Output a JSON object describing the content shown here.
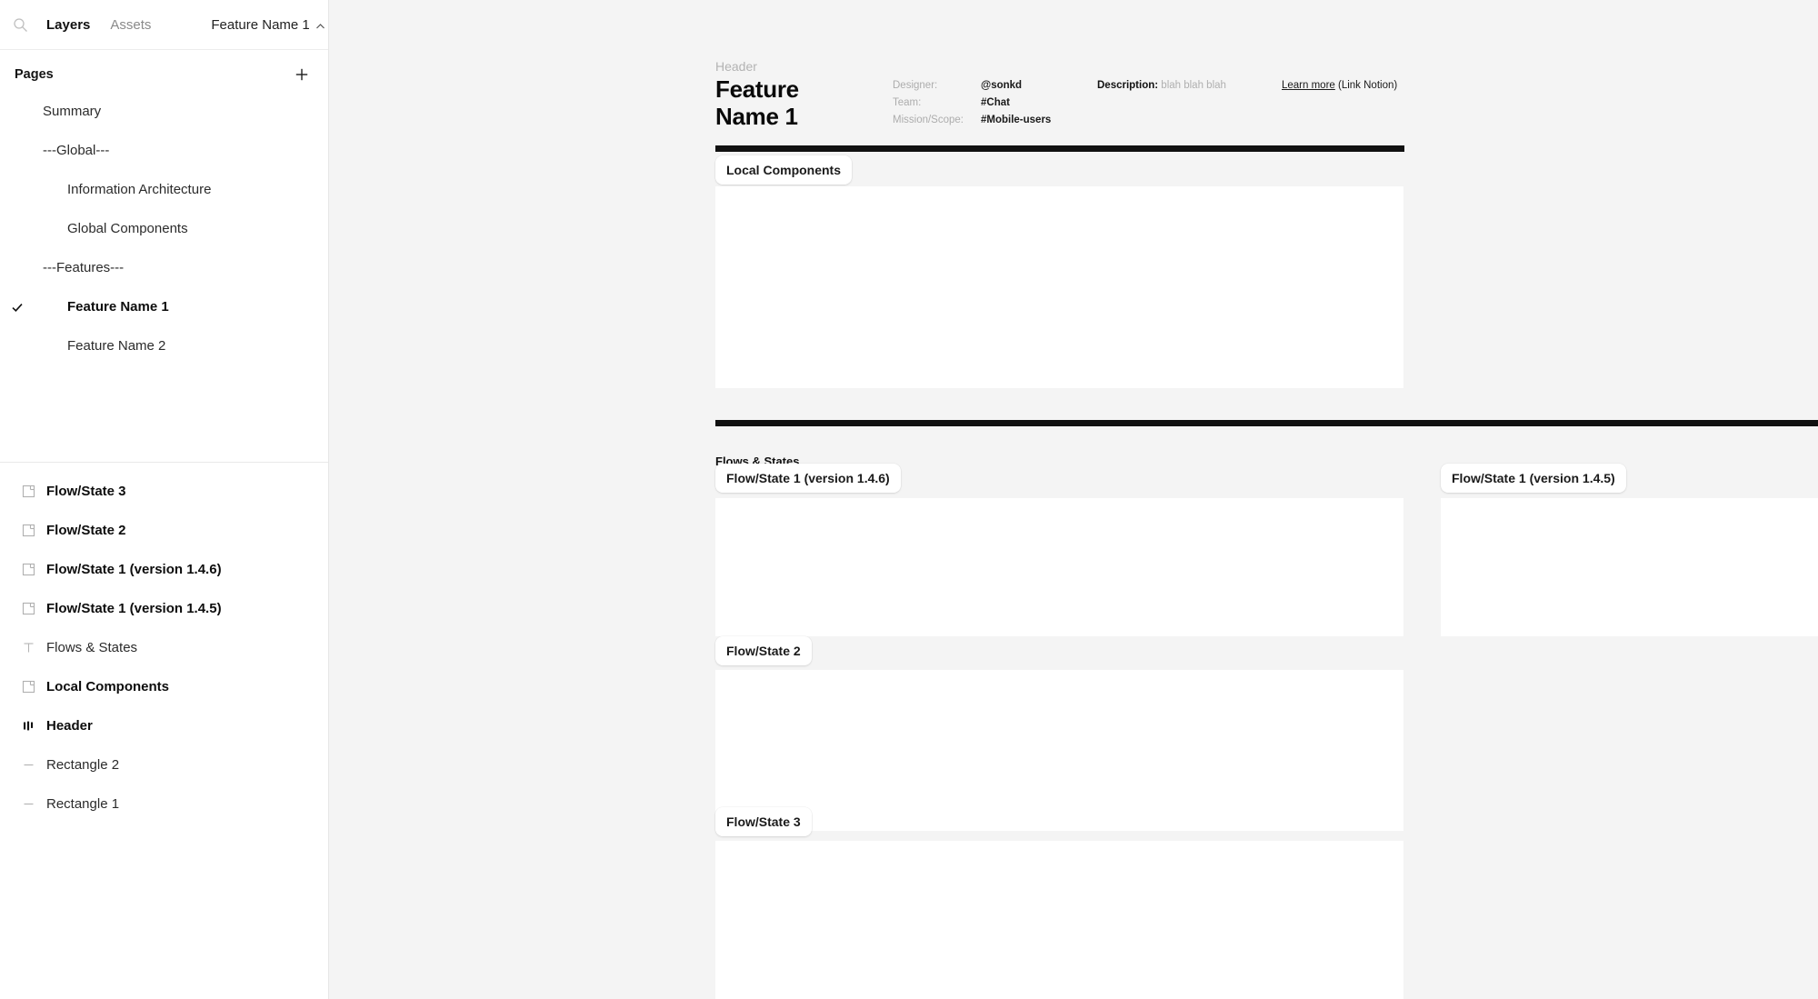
{
  "sidebar": {
    "toolbar": {
      "search_icon": "search-icon",
      "tabs": [
        {
          "label": "Layers",
          "active": true
        },
        {
          "label": "Assets",
          "active": false
        }
      ],
      "file_name": "Feature Name 1",
      "collapse_icon": "chevron-up-icon"
    },
    "pages": {
      "title": "Pages",
      "add_icon": "plus-icon",
      "items": [
        {
          "label": "Summary",
          "indent": 1,
          "selected": false
        },
        {
          "label": "---Global---",
          "indent": 1,
          "selected": false
        },
        {
          "label": "Information Architecture",
          "indent": 2,
          "selected": false
        },
        {
          "label": "Global Components",
          "indent": 2,
          "selected": false
        },
        {
          "label": "---Features---",
          "indent": 1,
          "selected": false
        },
        {
          "label": "Feature Name 1",
          "indent": 2,
          "selected": true
        },
        {
          "label": "Feature Name 2",
          "indent": 2,
          "selected": false
        }
      ]
    },
    "layers": [
      {
        "label": "Flow/State 3",
        "icon": "frame-icon",
        "bold": true
      },
      {
        "label": "Flow/State 2",
        "icon": "frame-icon",
        "bold": true
      },
      {
        "label": "Flow/State 1 (version 1.4.6)",
        "icon": "frame-icon",
        "bold": true
      },
      {
        "label": "Flow/State 1 (version 1.4.5)",
        "icon": "frame-icon",
        "bold": true
      },
      {
        "label": "Flows & States",
        "icon": "text-icon",
        "bold": false
      },
      {
        "label": "Local Components",
        "icon": "frame-icon",
        "bold": true
      },
      {
        "label": "Header",
        "icon": "component-icon",
        "bold": true
      },
      {
        "label": "Rectangle 2",
        "icon": "line-icon",
        "bold": false
      },
      {
        "label": "Rectangle 1",
        "icon": "line-icon",
        "bold": false
      }
    ]
  },
  "canvas": {
    "header": {
      "kicker": "Header",
      "title": "Feature\nName 1",
      "meta": [
        {
          "key": "Designer:",
          "value": "@sonkd"
        },
        {
          "key": "Team:",
          "value": "#Chat"
        },
        {
          "key": "Mission/Scope:",
          "value": "#Mobile-users"
        }
      ],
      "description_key": "Description:",
      "description_value": "blah blah blah",
      "link_label": "Learn more",
      "link_suffix": " (Link Notion)"
    },
    "sections": {
      "flows_states_label": "Flows & States"
    },
    "frames": {
      "local_components": "Local Components",
      "flow_state_1_146": "Flow/State 1 (version 1.4.6)",
      "flow_state_1_145": "Flow/State 1 (version 1.4.5)",
      "flow_state_2": "Flow/State 2",
      "flow_state_3": "Flow/State 3"
    }
  },
  "colors": {
    "canvas_background": "#f4f4f4",
    "frame_fill": "#ffffff",
    "rule": "#111111",
    "muted_text": "#b3b3b3"
  }
}
